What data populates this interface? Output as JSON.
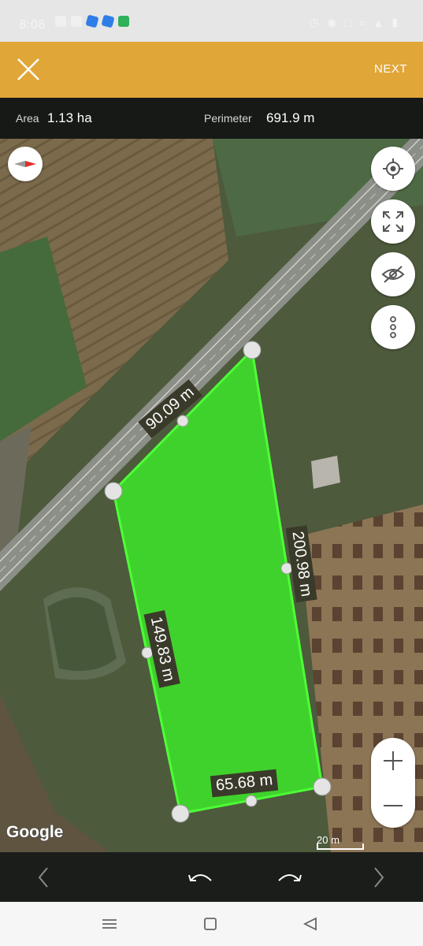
{
  "status_bar": {
    "time": "8:08"
  },
  "toolbar": {
    "next_label": "NEXT"
  },
  "info": {
    "area_label": "Area",
    "area_value": "1.13 ha",
    "perimeter_label": "Perimeter",
    "perimeter_value": "691.9 m"
  },
  "edges": {
    "north": "90.09 m",
    "east": "200.98 m",
    "west": "149.83 m",
    "south": "65.68 m"
  },
  "map": {
    "attribution": "Google",
    "scale_label": "20 m",
    "polygon_color": "#3ee829"
  },
  "icons": {
    "close": "close-icon",
    "compass": "compass-icon",
    "locate": "my-location-icon",
    "fit": "fit-bounds-icon",
    "visibility": "eye-off-icon",
    "more": "more-vertical-icon",
    "zoom_in": "plus-icon",
    "zoom_out": "minus-icon",
    "prev": "chevron-left-icon",
    "undo": "undo-icon",
    "redo": "redo-icon",
    "next": "chevron-right-icon"
  },
  "colors": {
    "accent": "#e0a637"
  }
}
